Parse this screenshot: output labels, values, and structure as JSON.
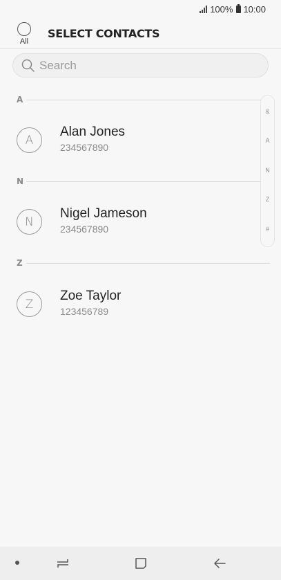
{
  "status_bar": {
    "battery": "100%",
    "time": "10:00"
  },
  "header": {
    "select_all_label": "All",
    "title": "SELECT CONTACTS"
  },
  "search": {
    "placeholder": "Search"
  },
  "sections": [
    {
      "letter": "A",
      "contacts": [
        {
          "initial": "A",
          "name": "Alan Jones",
          "number": "234567890"
        }
      ]
    },
    {
      "letter": "N",
      "contacts": [
        {
          "initial": "N",
          "name": "Nigel Jameson",
          "number": "234567890"
        }
      ]
    },
    {
      "letter": "Z",
      "contacts": [
        {
          "initial": "Z",
          "name": "Zoe Taylor",
          "number": "123456789"
        }
      ]
    }
  ],
  "index_scroller": [
    "&",
    "A",
    "N",
    "Z",
    "#"
  ],
  "nav_bar": {
    "buttons": [
      "dot-icon",
      "recent-apps-icon",
      "home-icon",
      "back-icon"
    ]
  },
  "colors": {
    "background": "#f7f7f7",
    "divider": "#d9d9d9",
    "secondary_text": "#8a8a8a"
  }
}
